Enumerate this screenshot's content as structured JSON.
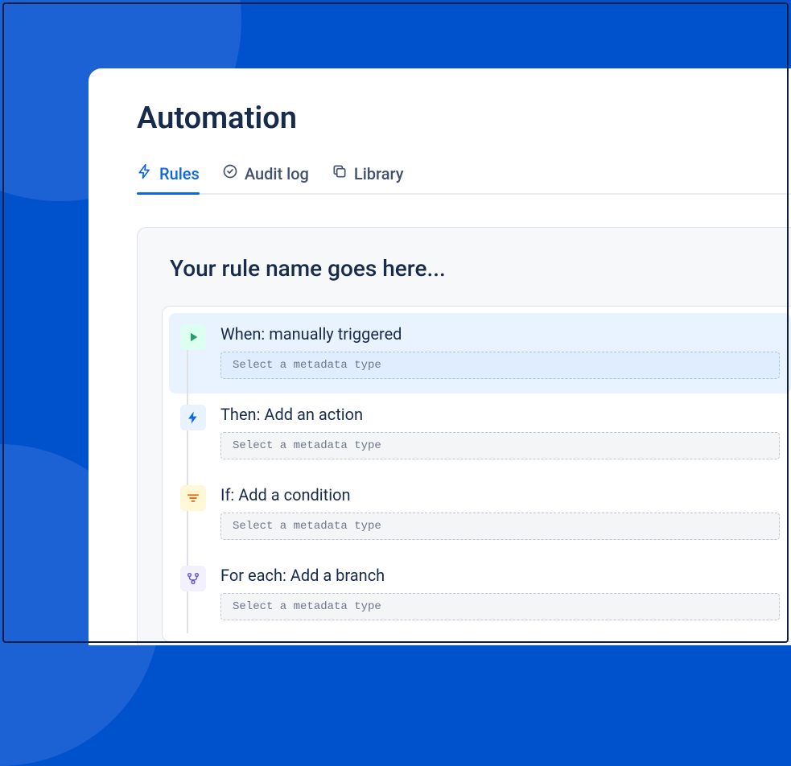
{
  "page": {
    "title": "Automation"
  },
  "tabs": [
    {
      "label": "Rules",
      "icon": "lightning-icon",
      "active": true
    },
    {
      "label": "Audit log",
      "icon": "check-circle-icon",
      "active": false
    },
    {
      "label": "Library",
      "icon": "copy-icon",
      "active": false
    }
  ],
  "rule": {
    "name": "Your rule name goes here...",
    "steps": [
      {
        "label": "When: manually triggered",
        "placeholder": "Select a metadata type",
        "icon": "play-icon",
        "color": "green",
        "selected": true
      },
      {
        "label": "Then: Add an action",
        "placeholder": "Select a metadata type",
        "icon": "bolt-icon",
        "color": "blue",
        "selected": false
      },
      {
        "label": "If: Add a condition",
        "placeholder": "Select a metadata type",
        "icon": "filter-icon",
        "color": "yellow",
        "selected": false
      },
      {
        "label": "For each: Add a branch",
        "placeholder": "Select a metadata type",
        "icon": "branch-icon",
        "color": "purple",
        "selected": false
      }
    ]
  }
}
